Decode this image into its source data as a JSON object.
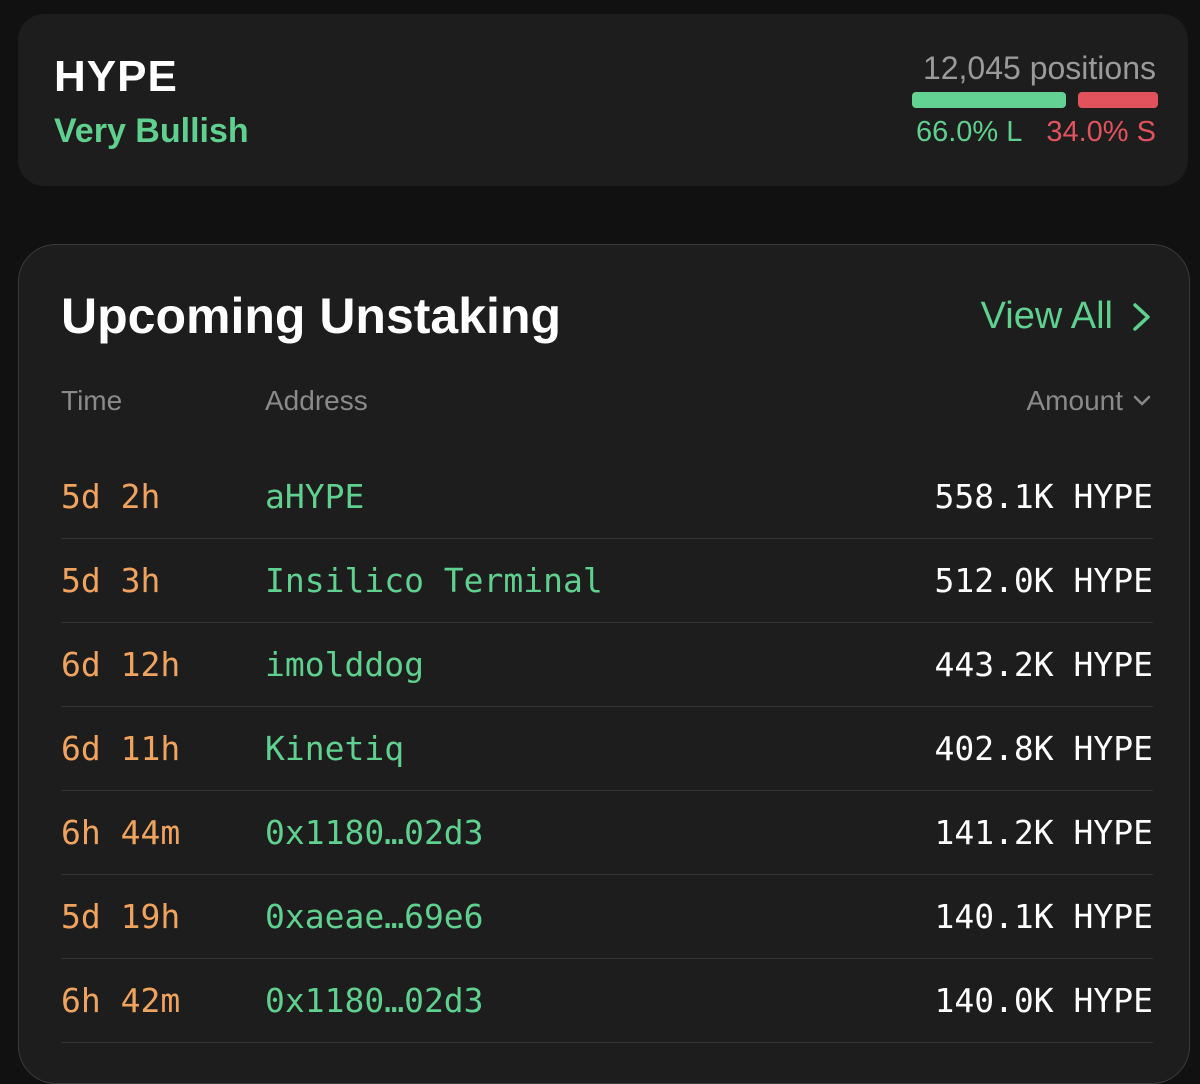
{
  "token": {
    "name": "HYPE",
    "sentiment": "Very Bullish",
    "positions": "12,045 positions",
    "long_pct_label": "66.0% L",
    "short_pct_label": "34.0% S",
    "long_fraction": 0.66,
    "short_fraction": 0.34
  },
  "unstaking": {
    "title": "Upcoming Unstaking",
    "view_all": "View All",
    "columns": {
      "time": "Time",
      "address": "Address",
      "amount": "Amount"
    },
    "rows": [
      {
        "time": "5d 2h",
        "address": "aHYPE",
        "amount": "558.1K HYPE"
      },
      {
        "time": "5d 3h",
        "address": "Insilico Terminal",
        "amount": "512.0K HYPE"
      },
      {
        "time": "6d 12h",
        "address": "imolddog",
        "amount": "443.2K HYPE"
      },
      {
        "time": "6d 11h",
        "address": "Kinetiq",
        "amount": "402.8K HYPE"
      },
      {
        "time": "6h 44m",
        "address": "0x1180…02d3",
        "amount": "141.2K HYPE"
      },
      {
        "time": "5d 19h",
        "address": "0xaeae…69e6",
        "amount": "140.1K HYPE"
      },
      {
        "time": "6h 42m",
        "address": "0x1180…02d3",
        "amount": "140.0K HYPE"
      }
    ]
  },
  "colors": {
    "background": "#111111",
    "card": "#1d1d1d",
    "accent_green": "#5fd08e",
    "short_red": "#e2525c",
    "time_orange": "#f0a35e",
    "muted": "#8a8a8a"
  },
  "icons": {
    "view_all": "chevron-right-icon",
    "amount_sort": "chevron-down-icon"
  }
}
